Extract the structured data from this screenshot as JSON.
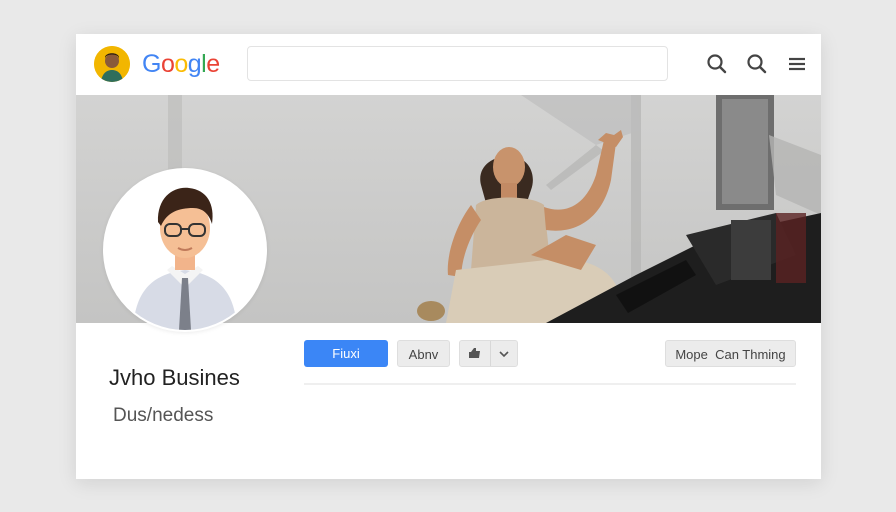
{
  "header": {
    "logo_letters": [
      {
        "ch": "G",
        "color": "#4285F4"
      },
      {
        "ch": "o",
        "color": "#EA4335"
      },
      {
        "ch": "o",
        "color": "#FBBC05"
      },
      {
        "ch": "g",
        "color": "#4285F4"
      },
      {
        "ch": "l",
        "color": "#34A853"
      },
      {
        "ch": "e",
        "color": "#EA4335"
      }
    ],
    "search_value": "",
    "icons": [
      "search-icon",
      "search-icon",
      "menu-icon"
    ]
  },
  "profile": {
    "name": "Jvho Busines",
    "subtitle": "Dus/nedess"
  },
  "actions": {
    "primary_label": "Fiuxi",
    "second_label": "Abnv",
    "split_icon": "thumb-icon",
    "split_dropdown_icon": "chevron-down-icon",
    "more_label": "Mope  Can Thming"
  },
  "colors": {
    "primary": "#3b86f6",
    "background": "#e9e9e9",
    "avatar_ring": "#f2b600"
  }
}
